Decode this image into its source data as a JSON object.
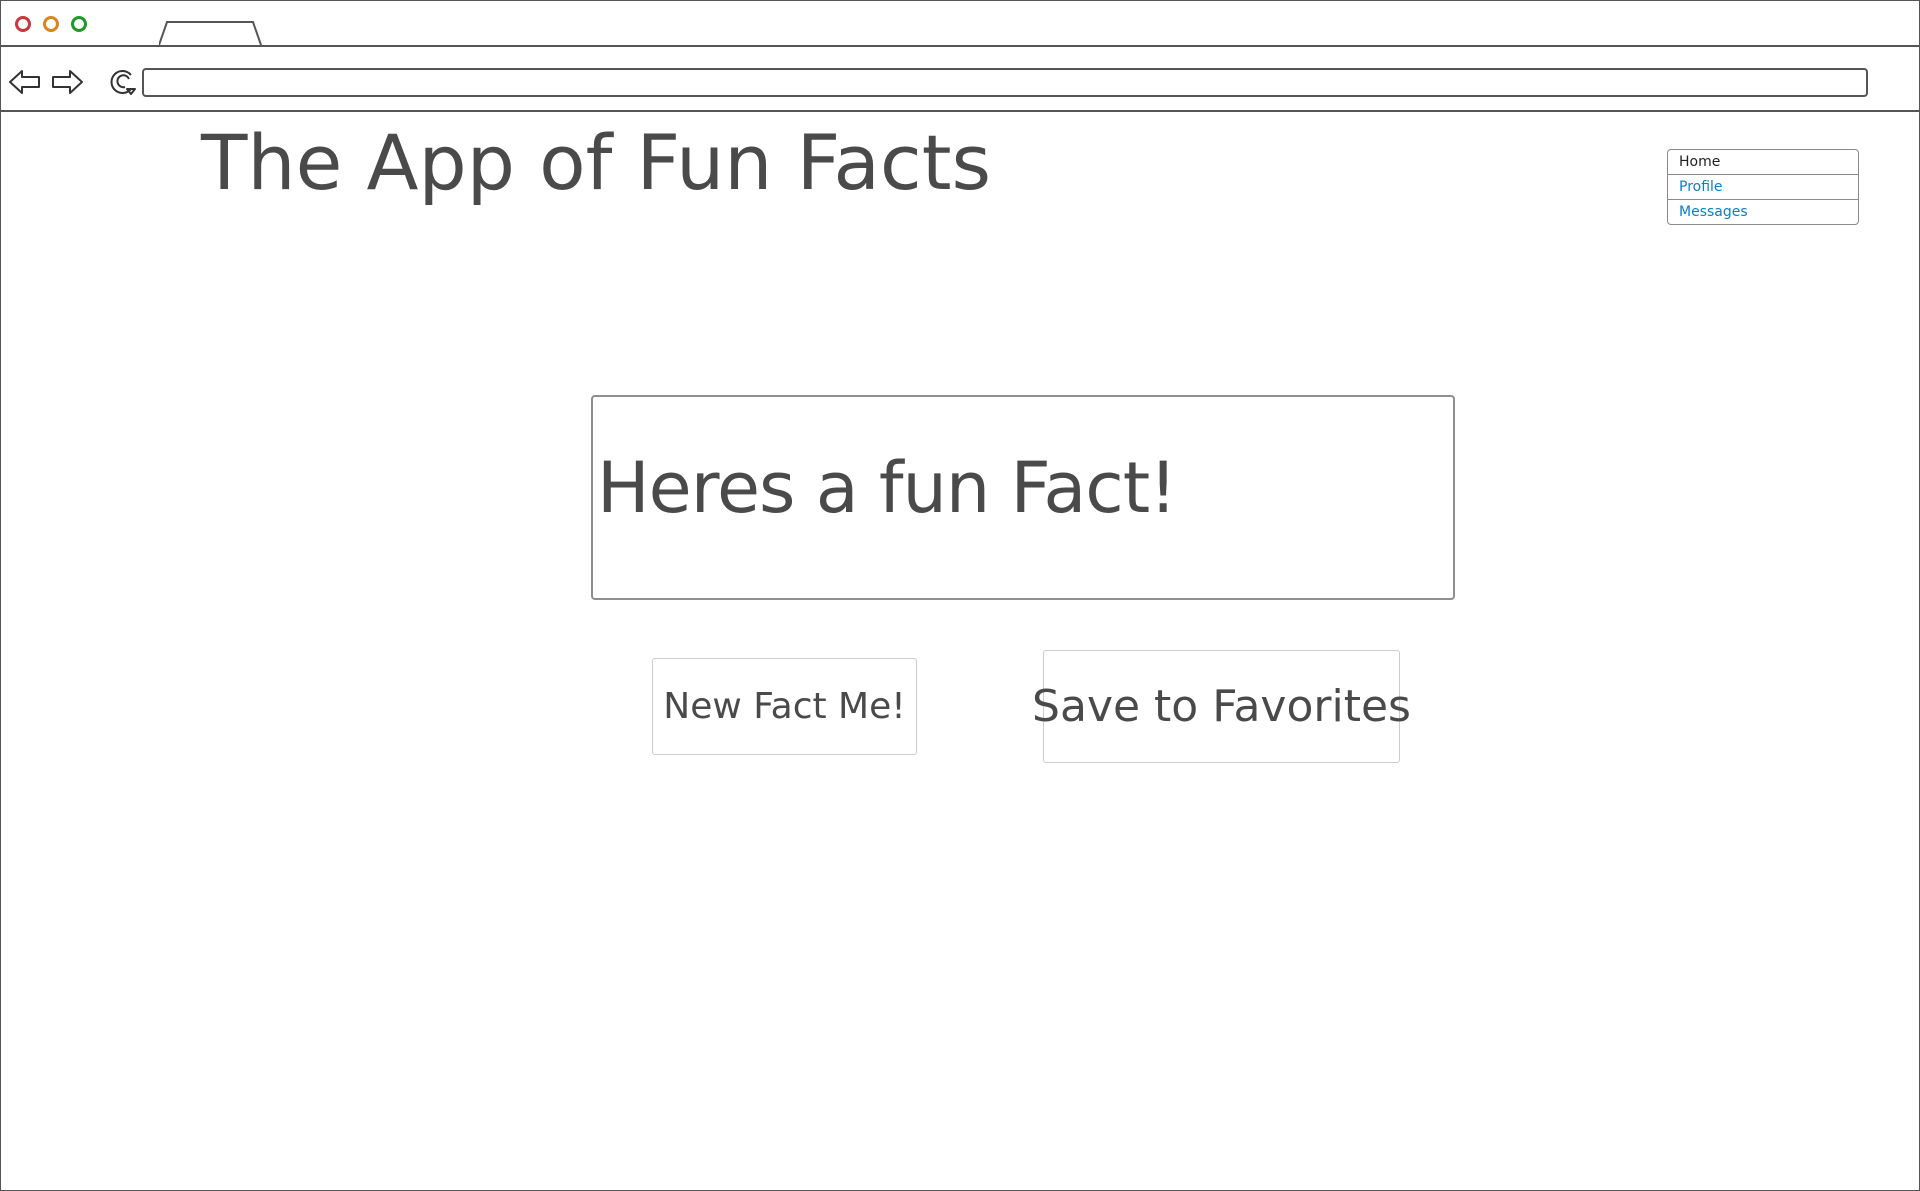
{
  "browser": {
    "tab_title": "",
    "address_value": ""
  },
  "page": {
    "title": "The App of Fun Facts"
  },
  "nav_menu": {
    "items": [
      {
        "label": "Home",
        "state": "active"
      },
      {
        "label": "Profile",
        "state": "link"
      },
      {
        "label": "Messages",
        "state": "link"
      }
    ]
  },
  "fact": {
    "text": "Heres a fun Fact!"
  },
  "actions": {
    "new_fact_label": "New Fact Me!",
    "save_label": "Save to Favorites"
  },
  "colors": {
    "link": "#0b7fc6",
    "text": "#4a4a4a",
    "close": "#c9373f",
    "minimize": "#d9861c",
    "maximize": "#1c9a2a"
  },
  "icons": [
    "back-arrow-icon",
    "forward-arrow-icon",
    "reload-icon"
  ]
}
